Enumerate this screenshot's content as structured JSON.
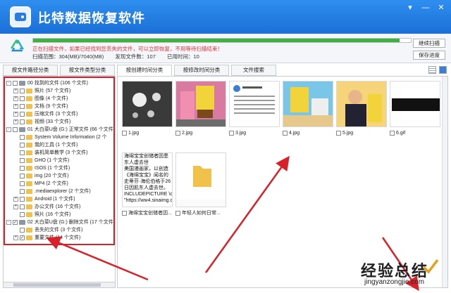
{
  "app": {
    "title": "比特数据恢复软件"
  },
  "window_buttons": [
    "▾",
    "—",
    "✕"
  ],
  "scan": {
    "progress": 0.97,
    "status": "正在扫描文件，如果已经找到您丢失的文件，可以立即恢复，不用等待扫描结束！",
    "range": "扫描范围：304(MB)/7040(MB)",
    "found": "发现文件数：107",
    "elapsed": "已用时间：10",
    "continue_label": "继续扫描",
    "save_label": "保存进度"
  },
  "tabs": [
    "按文件路径分类",
    "按文件类型分类",
    "按创建时间分类",
    "按修改时间分类",
    "文件搜索"
  ],
  "tree": [
    {
      "level": 0,
      "exp": "-",
      "cb": false,
      "icon": "drive",
      "label": "00 找到的文件  (106 个文件)"
    },
    {
      "level": 1,
      "exp": "+",
      "cb": false,
      "icon": "folder",
      "label": "照片    (57 个文件)"
    },
    {
      "level": 1,
      "exp": "+",
      "cb": false,
      "icon": "folder",
      "label": "图像    (4 个文件)"
    },
    {
      "level": 1,
      "exp": "+",
      "cb": false,
      "icon": "folder",
      "label": "文档    (9 个文件)"
    },
    {
      "level": 1,
      "exp": "+",
      "cb": false,
      "icon": "folder",
      "label": "压缩文件   (3 个文件)"
    },
    {
      "level": 1,
      "exp": "+",
      "cb": false,
      "icon": "folder",
      "label": "视频    (33 个文件)"
    },
    {
      "level": 0,
      "exp": "-",
      "cb": false,
      "icon": "drive",
      "label": "01 大白菜U盘 (G:) 正常文件 (66 个文件"
    },
    {
      "level": 1,
      "exp": "",
      "cb": false,
      "icon": "folder",
      "label": "System Volume Information   (2 个"
    },
    {
      "level": 1,
      "exp": "",
      "cb": false,
      "icon": "folder",
      "label": "我的工具   (1 个文件)"
    },
    {
      "level": 1,
      "exp": "",
      "cb": false,
      "icon": "folder",
      "label": "装机简单教学   (3 个文件)"
    },
    {
      "level": 1,
      "exp": "",
      "cb": false,
      "icon": "folder",
      "label": "GHO    (1 个文件)"
    },
    {
      "level": 1,
      "exp": "",
      "cb": false,
      "icon": "folder",
      "label": "ISOS    (1 个文件)"
    },
    {
      "level": 1,
      "exp": "",
      "cb": false,
      "icon": "folder",
      "label": "img    (20 个文件)"
    },
    {
      "level": 1,
      "exp": "",
      "cb": false,
      "icon": "folder",
      "label": "MP4    (2 个文件)"
    },
    {
      "level": 1,
      "exp": "",
      "cb": false,
      "icon": "folder",
      "label": ".mediaexplorer    (2 个文件)"
    },
    {
      "level": 1,
      "exp": "+",
      "cb": false,
      "icon": "folder",
      "label": "Android    (1 个文件)"
    },
    {
      "level": 1,
      "exp": "+",
      "cb": false,
      "icon": "folder",
      "label": "办公文件    (16 个文件)"
    },
    {
      "level": 1,
      "exp": "",
      "cb": false,
      "icon": "folder",
      "label": "照片    (16 个文件)"
    },
    {
      "level": 0,
      "exp": "-",
      "cb": true,
      "icon": "drive",
      "label": "02 大白菜U盘 (G:) 删除文件 (17 个文件"
    },
    {
      "level": 1,
      "exp": "",
      "cb": false,
      "icon": "folder",
      "label": "丢失的文件    (3 个文件)"
    },
    {
      "level": 1,
      "exp": "+",
      "cb": true,
      "icon": "folder",
      "label": "重要文件    (14 个文件)"
    }
  ],
  "files": [
    {
      "name": "1.jpg",
      "kind": "dark"
    },
    {
      "name": "2.jpg",
      "kind": "sponge"
    },
    {
      "name": "3.jpg",
      "kind": "tweet"
    },
    {
      "name": "4.jpg",
      "kind": "sponge2"
    },
    {
      "name": "5.jpg",
      "kind": "people"
    },
    {
      "name": "6.gif",
      "kind": "bar"
    },
    {
      "name": "海绵宝宝创储者因...",
      "kind": "text",
      "preview": [
        "海绵宝宝创储者因患",
        "东人虚去世",
        "美国漫画家，以创造",
        "《海绵宝宝》闻名的",
        "史蒂芬·海伦伯格于26",
        "日因肌东人虚去世。",
        "INCLUDEPICTURE \\d",
        "\"https://ww4.sinaimg.c"
      ]
    },
    {
      "name": "年轻人如何日常...",
      "kind": "folder"
    }
  ],
  "watermark": {
    "main": "经验总结",
    "sub": "jingyanzongjie.com"
  },
  "colors": {
    "titlebar": "#2f8ff0",
    "status_red": "#e0333b",
    "progress_green": "#3db23d",
    "annotation_red": "#d9212a"
  }
}
